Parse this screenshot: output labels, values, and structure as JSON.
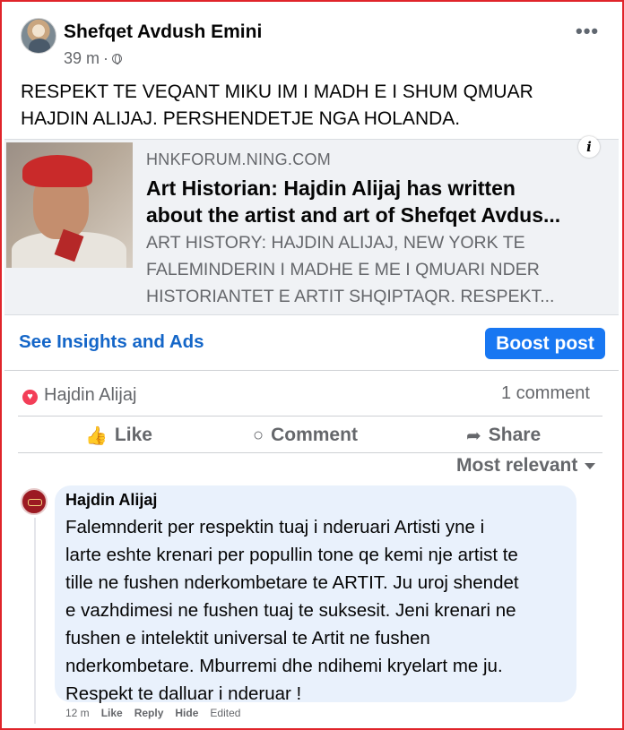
{
  "post": {
    "author": "Shefqet Avdush Emini",
    "time": "39 m",
    "separator": "·",
    "more_label": "•••",
    "text": "RESPEKT TE VEQANT MIKU IM I MADH E I SHUM QMUAR HAJDIN ALIJAJ. PERSHENDETJE NGA HOLANDA."
  },
  "link_preview": {
    "info_label": "i",
    "domain": "HNKFORUM.NING.COM",
    "title_lines": [
      "Art Historian: Hajdin Alijaj has written",
      "about the artist and art of Shefqet Avdus..."
    ],
    "description_lines": [
      "ART HISTORY: HAJDIN ALIJAJ, NEW YORK TE",
      "FALEMINDERIN I MADHE E ME I QMUARI NDER",
      "HISTORIANTET E ARTIT SHQIPTAQR. RESPEKT..."
    ]
  },
  "insights": {
    "link_label": "See Insights and Ads",
    "boost_label": "Boost post"
  },
  "reactions": {
    "love_symbol": "♥",
    "reactor": "Hajdin Alijaj",
    "comment_count": "1 comment"
  },
  "actions": {
    "like": "Like",
    "comment": "Comment",
    "share": "Share",
    "like_icon": "👍",
    "comment_icon": "○",
    "share_icon": "➦"
  },
  "sort": {
    "label": "Most relevant"
  },
  "comment": {
    "author": "Hajdin Alijaj",
    "lines": [
      "Falemnderit per respektin tuaj i nderuari Artisti yne i",
      "larte eshte krenari per popullin tone qe kemi nje artist te",
      "tille ne fushen nderkombetare te ARTIT. Ju uroj shendet",
      "e vazhdimesi ne fushen tuaj te suksesit. Jeni krenari ne",
      "fushen e intelektit universal te Artit ne fushen",
      "nderkombetare. Mburremi dhe ndihemi kryelart me ju.",
      "Respekt te dalluar i nderuar !"
    ],
    "time": "12 m",
    "like_label": "Like",
    "reply_label": "Reply",
    "hide_label": "Hide",
    "edited_label": "Edited"
  },
  "colors": {
    "frame": "#e0242a",
    "accent": "#1877f2",
    "link": "#1466c8",
    "love": "#f33e58",
    "bubble": "#e9f1fc"
  }
}
